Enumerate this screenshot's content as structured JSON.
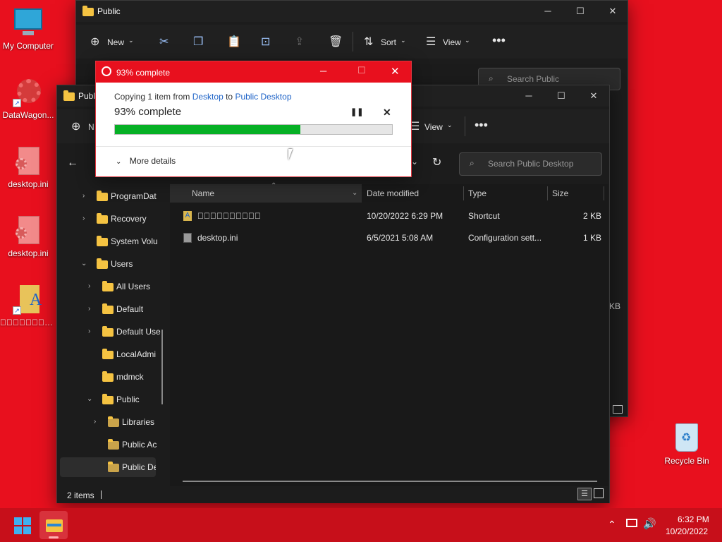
{
  "desktop": {
    "icons": [
      {
        "label": "My Computer"
      },
      {
        "label": "DataWagon..."
      },
      {
        "label": "desktop.ini"
      },
      {
        "label": "desktop.ini"
      },
      {
        "label": "\u0000\u0000\u0000\u0000\u0000\u0000\u0000\u0000..."
      },
      {
        "label": "Recycle Bin"
      }
    ]
  },
  "back_window": {
    "title": "Public",
    "toolbar": {
      "new_label": "New",
      "sort_label": "Sort",
      "view_label": "View"
    },
    "search_placeholder": "Search Public",
    "partial_text": "KB"
  },
  "front_window": {
    "title": "Public Desktop",
    "title_visible": "Publi",
    "toolbar": {
      "new_label": "N",
      "view_label": "View"
    },
    "search_placeholder": "Search Public Desktop",
    "tree": [
      {
        "label": "ProgramDat"
      },
      {
        "label": "Recovery"
      },
      {
        "label": "System Volu"
      },
      {
        "label": "Users"
      },
      {
        "label": "All Users"
      },
      {
        "label": "Default"
      },
      {
        "label": "Default Use"
      },
      {
        "label": "LocalAdmi"
      },
      {
        "label": "mdmck"
      },
      {
        "label": "Public"
      },
      {
        "label": "Libraries"
      },
      {
        "label": "Public Ac"
      },
      {
        "label": "Public De"
      }
    ],
    "columns": {
      "name": "Name",
      "date": "Date modified",
      "type": "Type",
      "size": "Size"
    },
    "files": [
      {
        "name": "\u0000\u0000\u0000\u0000\u0000\u0000\u0000\u0000\u0000\u0000\u0000\u0000\u0000\u0000\u0000\u0000\u0000\u0000\u0000\u0000",
        "date": "10/20/2022 6:29 PM",
        "type": "Shortcut",
        "size": "2 KB"
      },
      {
        "name": "desktop.ini",
        "date": "6/5/2021 5:08 AM",
        "type": "Configuration sett...",
        "size": "1 KB"
      }
    ],
    "status": "2 items"
  },
  "copy_dialog": {
    "title": "93% complete",
    "copying_prefix": "Copying 1 item from",
    "source": "Desktop",
    "to_word": "to",
    "destination": "Public Desktop",
    "progress_text": "93% complete",
    "progress_fraction": 0.67,
    "more_details": "More details"
  },
  "taskbar": {
    "time": "6:32 PM",
    "date": "10/20/2022"
  }
}
